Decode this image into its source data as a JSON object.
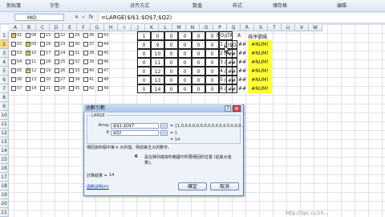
{
  "ribbon": {
    "items": [
      "剪贴簿",
      "字型",
      "对齐方式",
      "数值",
      "样式",
      "储存格",
      "编辑"
    ]
  },
  "formula_bar": {
    "name_box": "MID",
    "cancel": "✕",
    "enter": "✓",
    "fx": "fx",
    "formula": "=LARGE($I$1:$O$7,$Q2)"
  },
  "columns": [
    "A",
    "B",
    "C",
    "D",
    "E",
    "F",
    "G",
    "H",
    "I",
    "J",
    "K",
    "L",
    "M",
    "N",
    "O",
    "P",
    "Q",
    "R",
    "S",
    "T",
    "U",
    "V",
    "W"
  ],
  "rows": [
    "1",
    "2",
    "3",
    "4",
    "5",
    "6",
    "7",
    "8",
    "9",
    "10",
    "11",
    "12",
    "13",
    "14",
    "15",
    "16",
    "17",
    "18",
    "19",
    "20",
    "21",
    "22"
  ],
  "checkbox_grid": [
    {
      "row": 1,
      "items": [
        {
          "n": "01",
          "on": true
        },
        {
          "n": "08",
          "on": false
        },
        {
          "n": "15",
          "on": false
        },
        {
          "n": "22",
          "on": false
        },
        {
          "n": "29",
          "on": false
        },
        {
          "n": "36",
          "on": false
        },
        {
          "n": "43",
          "on": false
        }
      ]
    },
    {
      "row": 2,
      "items": [
        {
          "n": "02",
          "on": false
        },
        {
          "n": "09",
          "on": true
        },
        {
          "n": "16",
          "on": false
        },
        {
          "n": "23",
          "on": false
        },
        {
          "n": "30",
          "on": false
        },
        {
          "n": "37",
          "on": false
        },
        {
          "n": "44",
          "on": false
        }
      ]
    },
    {
      "row": 3,
      "items": [
        {
          "n": "03",
          "on": false
        },
        {
          "n": "10",
          "on": true
        },
        {
          "n": "17",
          "on": false
        },
        {
          "n": "24",
          "on": false
        },
        {
          "n": "31",
          "on": false
        },
        {
          "n": "38",
          "on": false
        },
        {
          "n": "45",
          "on": false
        }
      ]
    },
    {
      "row": 4,
      "items": [
        {
          "n": "04",
          "on": false
        },
        {
          "n": "11",
          "on": false
        },
        {
          "n": "18",
          "on": false
        },
        {
          "n": "25",
          "on": false
        },
        {
          "n": "32",
          "on": false
        },
        {
          "n": "39",
          "on": false
        },
        {
          "n": "46",
          "on": false
        }
      ]
    },
    {
      "row": 5,
      "items": [
        {
          "n": "05",
          "on": false
        },
        {
          "n": "12",
          "on": true
        },
        {
          "n": "19",
          "on": false
        },
        {
          "n": "26",
          "on": false
        },
        {
          "n": "33",
          "on": false
        },
        {
          "n": "40",
          "on": false
        },
        {
          "n": "47",
          "on": false
        }
      ]
    },
    {
      "row": 6,
      "items": [
        {
          "n": "06",
          "on": false
        },
        {
          "n": "13",
          "on": false
        },
        {
          "n": "20",
          "on": false
        },
        {
          "n": "27",
          "on": false
        },
        {
          "n": "34",
          "on": false
        },
        {
          "n": "41",
          "on": false
        },
        {
          "n": "48",
          "on": false
        }
      ]
    },
    {
      "row": 7,
      "items": [
        {
          "n": "07",
          "on": false
        },
        {
          "n": "14",
          "on": false
        },
        {
          "n": "21",
          "on": false
        },
        {
          "n": "28",
          "on": false
        },
        {
          "n": "35",
          "on": false
        },
        {
          "n": "42",
          "on": false
        },
        {
          "n": "49",
          "on": false
        }
      ]
    }
  ],
  "value_table": [
    [
      "1",
      "0",
      "0",
      "0",
      "0",
      "0",
      "0"
    ],
    [
      "0",
      "9",
      "0",
      "0",
      "0",
      "0",
      "0"
    ],
    [
      "0",
      "10",
      "0",
      "0",
      "0",
      "0",
      "0"
    ],
    [
      "0",
      "11",
      "0",
      "0",
      "0",
      "0",
      "0"
    ],
    [
      "0",
      "12",
      "0",
      "0",
      "0",
      "0",
      "0"
    ],
    [
      "0",
      "13",
      "0",
      "0",
      "0",
      "0",
      "0"
    ],
    [
      "0",
      "14",
      "0",
      "0",
      "0",
      "0",
      "0"
    ]
  ],
  "side_table": {
    "headers": {
      "no": "NO",
      "ta": "TA",
      "a": "A",
      "t": "排序號碼"
    },
    "no": [
      "1",
      "2",
      "3",
      "4",
      "5",
      "6"
    ],
    "ta": [
      "($Q",
      "##",
      "##",
      "##",
      "##",
      "##"
    ],
    "ta2": [
      "##",
      "##",
      "##",
      "##",
      "##",
      "##"
    ],
    "t": [
      "#NUM!",
      "#NUM!",
      "#NUM!",
      "#NUM!",
      "#NUM!",
      "#NUM!"
    ]
  },
  "dialog": {
    "title": "函數引數",
    "help": "?",
    "close": "✕",
    "func": "LARGE",
    "array_label": "Array",
    "array_value": "$I$1:$O$7",
    "array_result": "= {1,0,0,0,0,0,0,0,0,0,0,0,0,0,0,0,0...",
    "k_label": "K",
    "k_value": "$Q2",
    "k_result": "= 1",
    "total_result": "= 14",
    "desc1": "傳回資料組中第 k 大的值。例如第五大的數字。",
    "desc2_label": "K",
    "desc2": "是在陣列或資料範圍中所要傳回的位置 (從最大值算)。",
    "calc_label": "計算結果 =",
    "calc_value": "14",
    "help_link": "函數說明(H)",
    "ok": "確定",
    "cancel": "取消"
  },
  "watermark": "http://3pc.cc/10..."
}
